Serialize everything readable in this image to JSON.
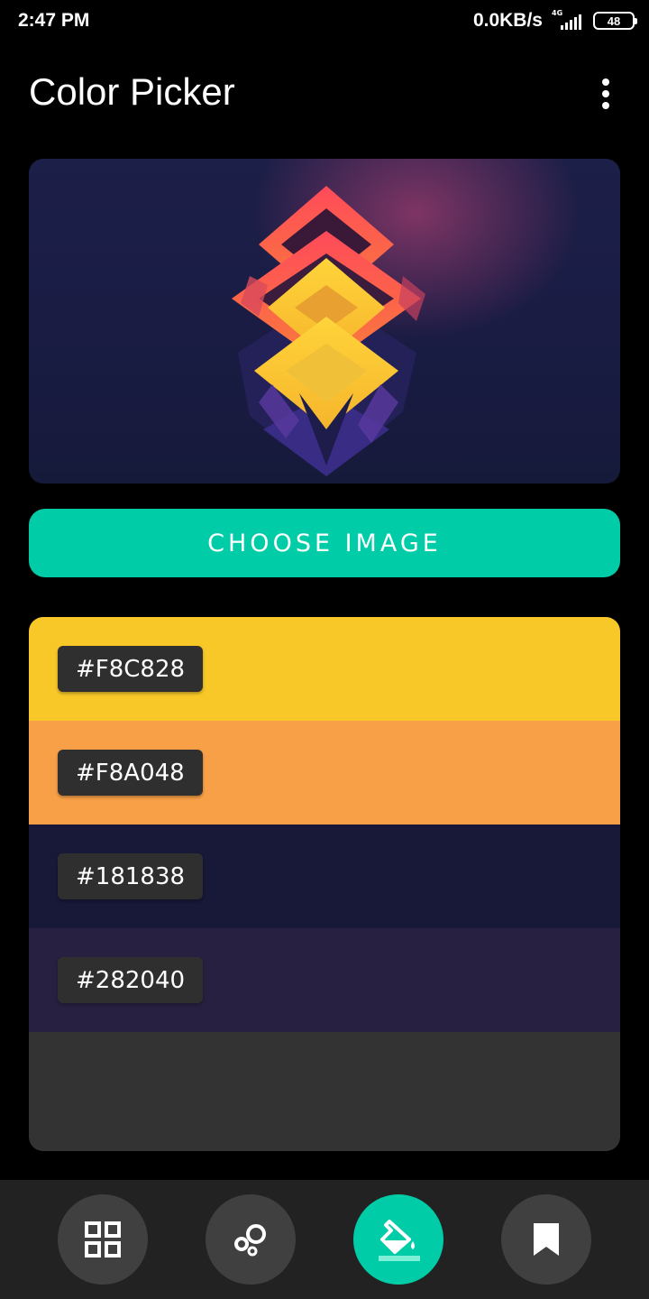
{
  "status_bar": {
    "time": "2:47 PM",
    "speed": "0.0KB/s",
    "network": "4G",
    "battery": "48"
  },
  "app_bar": {
    "title": "Color Picker",
    "menu_icon": "more-vert-icon"
  },
  "image_preview": {
    "content": "abstract geometric artwork"
  },
  "choose_image_button": {
    "label": "CHOOSE IMAGE",
    "color": "#00cda7"
  },
  "palette": {
    "swatches": [
      {
        "hex": "#F8C828",
        "color": "#F8C828"
      },
      {
        "hex": "#F8A048",
        "color": "#F8A048"
      },
      {
        "hex": "#181838",
        "color": "#181838"
      },
      {
        "hex": "#282040",
        "color": "#282040"
      }
    ],
    "empty_color": "#333333"
  },
  "bottom_nav": {
    "items": [
      {
        "icon": "dashboard-icon",
        "active": false
      },
      {
        "icon": "bubbles-icon",
        "active": false
      },
      {
        "icon": "paint-bucket-icon",
        "active": true
      },
      {
        "icon": "bookmark-icon",
        "active": false
      }
    ]
  }
}
